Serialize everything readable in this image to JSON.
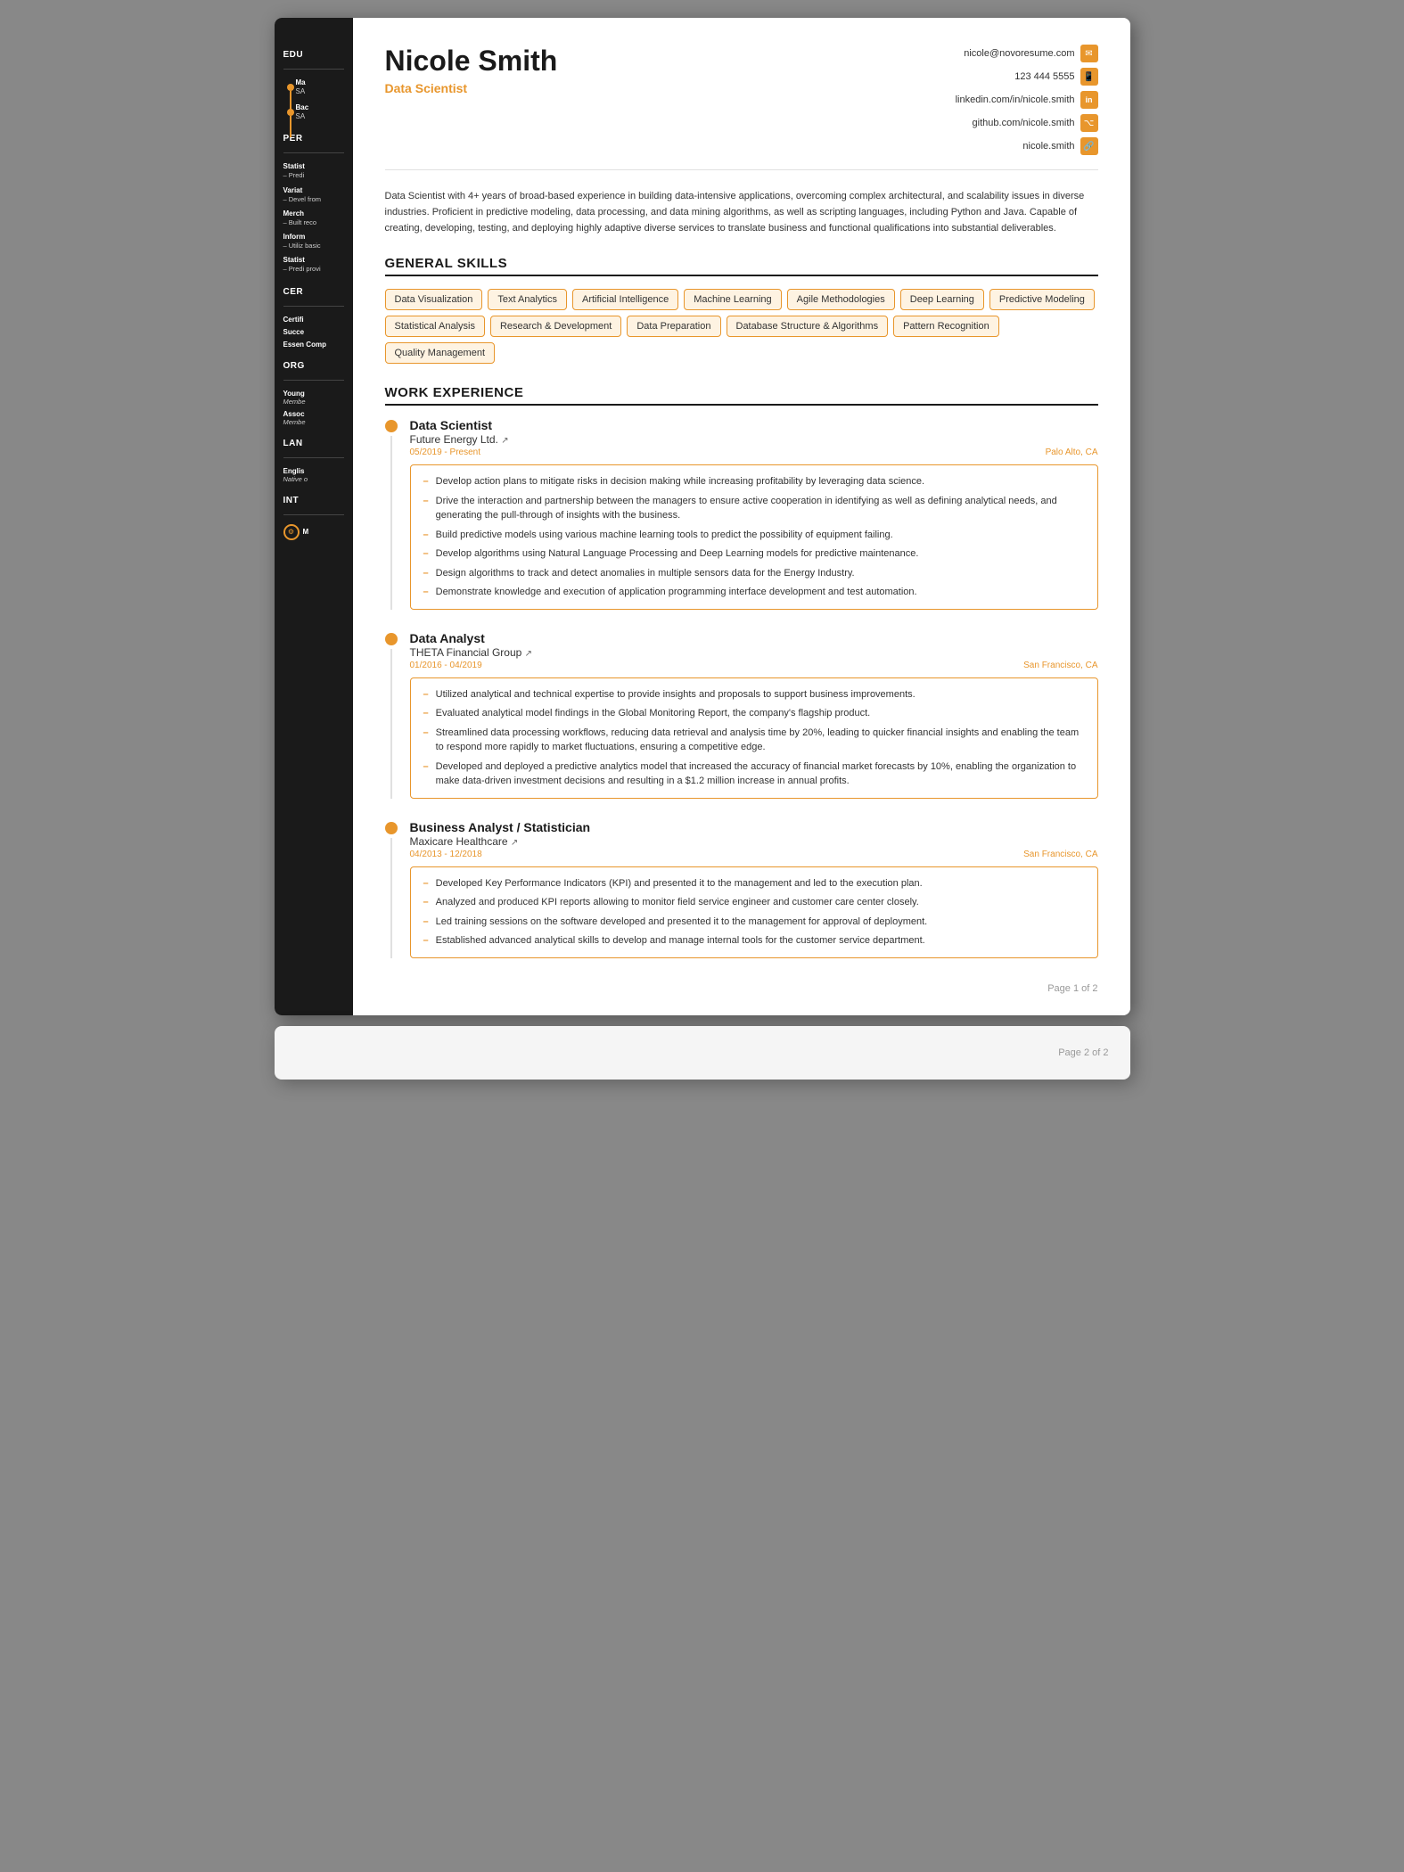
{
  "header": {
    "name": "Nicole Smith",
    "title": "Data Scientist",
    "contact": {
      "email": "nicole@novoresume.com",
      "phone": "123 444 5555",
      "linkedin": "linkedin.com/in/nicole.smith",
      "github": "github.com/nicole.smith",
      "website": "nicole.smith"
    }
  },
  "summary": "Data Scientist with 4+ years of broad-based experience in building data-intensive applications, overcoming complex architectural, and scalability issues in diverse industries. Proficient in predictive modeling, data processing, and data mining algorithms, as well as scripting languages, including Python and Java. Capable of creating, developing, testing, and deploying highly adaptive diverse services to translate business and functional qualifications into substantial deliverables.",
  "sections": {
    "general_skills": "GENERAL SKILLS",
    "work_experience": "WORK EXPERIENCE"
  },
  "skills": [
    "Data Visualization",
    "Text Analytics",
    "Artificial Intelligence",
    "Machine Learning",
    "Agile Methodologies",
    "Deep Learning",
    "Predictive Modeling",
    "Statistical Analysis",
    "Research & Development",
    "Data Preparation",
    "Database Structure & Algorithms",
    "Pattern Recognition",
    "Quality Management"
  ],
  "work_entries": [
    {
      "title": "Data Scientist",
      "company": "Future Energy Ltd.",
      "date": "05/2019 - Present",
      "location": "Palo Alto, CA",
      "bullets": [
        "Develop action plans to mitigate risks in decision making while increasing profitability by leveraging data science.",
        "Drive the interaction and partnership between the managers to ensure active cooperation in identifying as well as defining analytical needs, and generating the pull-through of insights with the business.",
        "Build predictive models using various machine learning tools to predict the possibility of equipment failing.",
        "Develop algorithms using Natural Language Processing and Deep Learning models for predictive maintenance.",
        "Design algorithms to track and detect anomalies in multiple sensors data for the Energy Industry.",
        "Demonstrate knowledge and execution of application programming interface development and test automation."
      ]
    },
    {
      "title": "Data Analyst",
      "company": "THETA Financial Group",
      "date": "01/2016 - 04/2019",
      "location": "San Francisco, CA",
      "bullets": [
        "Utilized analytical and technical expertise to provide insights and proposals to support business improvements.",
        "Evaluated analytical model findings in the Global Monitoring Report, the company's flagship product.",
        "Streamlined data processing workflows, reducing data retrieval and analysis time by 20%, leading to quicker financial insights and enabling the team to respond more rapidly to market fluctuations, ensuring a competitive edge.",
        "Developed and deployed a predictive analytics model that increased the accuracy of financial market forecasts by 10%, enabling the organization to make data-driven investment decisions and resulting in a $1.2 million increase in annual profits."
      ]
    },
    {
      "title": "Business Analyst / Statistician",
      "company": "Maxicare Healthcare",
      "date": "04/2013 - 12/2018",
      "location": "San Francisco, CA",
      "bullets": [
        "Developed Key Performance Indicators (KPI) and presented it to the management and led to the execution plan.",
        "Analyzed and produced KPI reports allowing to monitor field service engineer and customer care center closely.",
        "Led training sessions on the software developed and presented it to the management for approval of deployment.",
        "Established advanced analytical skills to develop and manage internal tools for the customer service department."
      ]
    }
  ],
  "sidebar": {
    "sections": {
      "education": "EDU",
      "personal": "PER",
      "certifications": "CER",
      "organizations": "ORG",
      "languages": "LAN",
      "interests": "INT"
    },
    "education_items": [
      {
        "degree": "Ma",
        "school": "SA"
      },
      {
        "degree": "Bac",
        "school": "SA"
      }
    ],
    "personal_items": [
      {
        "label": "Statist",
        "sub": "Predi"
      },
      {
        "label": "Variat",
        "sub": "Devel from"
      },
      {
        "label": "Merch",
        "sub": "Built reco"
      },
      {
        "label": "Inform",
        "sub": "Utiliz basic"
      },
      {
        "label": "Statist",
        "sub": "Predi provi"
      }
    ],
    "cert_items": [
      {
        "label": "Certifi"
      },
      {
        "label": "Succe"
      },
      {
        "label": "Essen Comp"
      }
    ],
    "org_items": [
      {
        "label": "Young",
        "sub": "Membe"
      },
      {
        "label": "Assoc",
        "sub": "Membe"
      }
    ],
    "lang_items": [
      {
        "label": "Englis",
        "sub": "Native o"
      }
    ],
    "interest_items": [
      {
        "icon": "⚙",
        "label": "M"
      }
    ]
  },
  "page_numbers": {
    "page1": "Page 1 of 2",
    "page2": "Page 2 of 2"
  }
}
